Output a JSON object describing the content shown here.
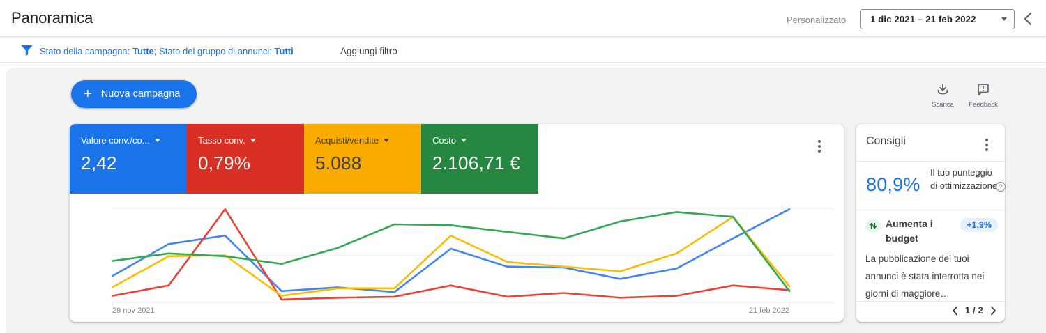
{
  "header": {
    "title": "Panoramica",
    "custom_label": "Personalizzato",
    "date_range": "1 dic 2021 – 21 feb 2022"
  },
  "filters": {
    "campaign_status_label": "Stato della campagna: ",
    "campaign_status_value": "Tutte",
    "separator": "; ",
    "adgroup_status_label": "Stato del gruppo di annunci: ",
    "adgroup_status_value": "Tutti",
    "add_filter": "Aggiungi filtro"
  },
  "toolbar": {
    "new_campaign": "Nuova campagna",
    "download_label": "Scarica",
    "feedback_label": "Feedback"
  },
  "metrics": {
    "tiles": [
      {
        "label": "Valore conv./co...",
        "value": "2,42",
        "bg": "#1a73e8",
        "text": "#ffffff"
      },
      {
        "label": "Tasso conv.",
        "value": "0,79%",
        "bg": "#d93025",
        "text": "#ffffff"
      },
      {
        "label": "Acquisti/vendite",
        "value": "5.088",
        "bg": "#f9ab00",
        "text": "#3c4043"
      },
      {
        "label": "Costo",
        "value": "2.106,71 €",
        "bg": "#268740",
        "text": "#ffffff"
      }
    ]
  },
  "chart_data": {
    "type": "line",
    "x_description": "13 weekly points from 29 nov 2021 to 21 feb 2022",
    "x_tick_labels": [
      "29 nov 2021",
      "21 feb 2022"
    ],
    "y_axis": "unlabeled; values are relative height 0-100 (100 = top gridline)",
    "grid": "3 horizontal gridlines (top, middle, bottom)",
    "series": [
      {
        "name": "Valore conv./costo",
        "color": "#4285f4",
        "values": [
          28,
          62,
          71,
          12,
          16,
          11,
          57,
          38,
          37,
          25,
          36,
          68,
          99
        ]
      },
      {
        "name": "Tasso conv.",
        "color": "#ea4335",
        "values": [
          7,
          18,
          99,
          3,
          5,
          6,
          18,
          6,
          10,
          5,
          7,
          18,
          13
        ]
      },
      {
        "name": "Acquisti/vendite",
        "color": "#fbbc04",
        "values": [
          16,
          49,
          50,
          7,
          15,
          15,
          71,
          43,
          38,
          33,
          52,
          91,
          17
        ]
      },
      {
        "name": "Costo",
        "color": "#34a853",
        "values": [
          44,
          52,
          49,
          41,
          58,
          83,
          82,
          75,
          68,
          86,
          96,
          91,
          12
        ]
      }
    ]
  },
  "recommendations": {
    "title": "Consigli",
    "score_value": "80,9%",
    "score_label": "Il tuo punteggio di ottimizzazione",
    "item": {
      "title": "Aumenta i budget",
      "badge": "+1,9%",
      "description": "La pubblicazione dei tuoi annunci è stata interrotta nei giorni di maggiore…"
    },
    "pagination": "1 / 2"
  },
  "colors": {
    "accent_blue": "#1a73e8",
    "score_blue": "#1a73e8",
    "badge_bg": "#e8f0fe",
    "reco_icon_green": "#137333",
    "grid_line": "#e6e8eb",
    "text_dark": "#3c4043",
    "text_gray": "#5f6368"
  }
}
